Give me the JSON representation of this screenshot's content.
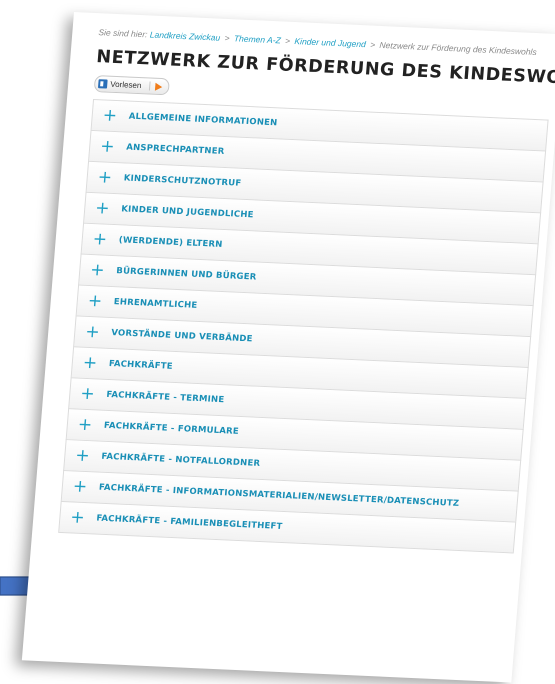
{
  "breadcrumb": {
    "prefix": "Sie sind hier:",
    "items": [
      "Landkreis Zwickau",
      "Themen A-Z",
      "Kinder und Jugend",
      "Netzwerk zur Förderung des Kindeswohls"
    ],
    "separator": ">"
  },
  "page_title": "NETZWERK ZUR FÖRDERUNG DES KINDESWOHLS",
  "read_aloud": {
    "label": "Vorlesen",
    "icon": "speaker-icon",
    "play_icon": "play-icon",
    "play_color": "#f07c1a"
  },
  "accordion": {
    "items": [
      "ALLGEMEINE INFORMATIONEN",
      "ANSPRECHPARTNER",
      "KINDERSCHUTZNOTRUF",
      "KINDER UND JUGENDLICHE",
      "(WERDENDE) ELTERN",
      "BÜRGERINNEN UND BÜRGER",
      "EHRENAMTLICHE",
      "VORSTÄNDE UND VERBÄNDE",
      "FACHKRÄFTE",
      "FACHKRÄFTE - TERMINE",
      "FACHKRÄFTE - FORMULARE",
      "FACHKRÄFTE - NOTFALLORDNER",
      "FACHKRÄFTE - INFORMATIONSMATERIALIEN/NEWSLETTER/DATENSCHUTZ",
      "FACHKRÄFTE - FAMILIENBEGLEITHEFT"
    ],
    "expand_symbol": "+"
  },
  "colors": {
    "accent": "#1f9fc4",
    "arrow": "#4472c4"
  }
}
